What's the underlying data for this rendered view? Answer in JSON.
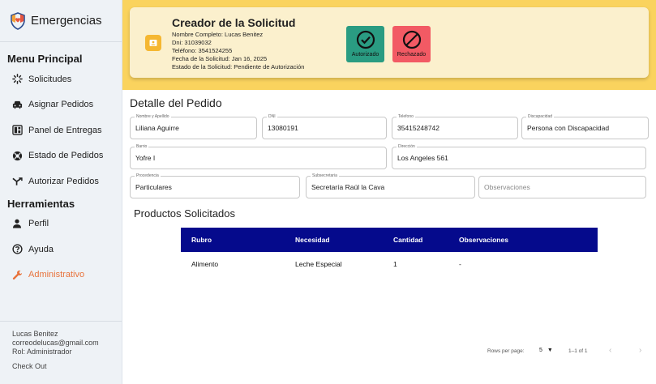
{
  "sidebar": {
    "brand": "Emergencias",
    "section_main": "Menu Principal",
    "main_items": [
      {
        "label": "Solicitudes",
        "icon": "spinner-icon"
      },
      {
        "label": "Asignar Pedidos",
        "icon": "car-icon"
      },
      {
        "label": "Panel de Entregas",
        "icon": "dashboard-icon"
      },
      {
        "label": "Estado de Pedidos",
        "icon": "support-icon"
      },
      {
        "label": "Autorizar Pedidos",
        "icon": "merge-icon"
      }
    ],
    "section_tools": "Herramientas",
    "tool_items": [
      {
        "label": "Perfil",
        "icon": "person-icon"
      },
      {
        "label": "Ayuda",
        "icon": "help-icon"
      },
      {
        "label": "Administrativo",
        "icon": "wrench-icon",
        "active": true
      }
    ],
    "user": {
      "name": "Lucas Benitez",
      "email": "correodelucas@gmail.com",
      "role": "Rol: Administrador",
      "checkout": "Check Out"
    }
  },
  "request": {
    "title": "Creador de la Solicitud",
    "name_line": "Nombre Completo: Lucas Benitez",
    "dni_line": "Dni: 31039032",
    "phone_line": "Teléfono: 3541524255",
    "date_line": "Fecha de la Solicitud: Jan 16, 2025",
    "status_line": "Estado de la Solicitud: Pendiente de Autorización",
    "approve_label": "Autorizado",
    "reject_label": "Rechazado"
  },
  "detail": {
    "title": "Detalle del Pedido",
    "fields": {
      "nombre": {
        "label": "Nombre y Apellido",
        "value": "Liliana Aguirre"
      },
      "dni": {
        "label": "DNI",
        "value": "13080191"
      },
      "telefono": {
        "label": "Telefono",
        "value": "35415248742"
      },
      "discapacidad": {
        "label": "Discapacidad",
        "value": "Persona con Discapacidad"
      },
      "barrio": {
        "label": "Barrio",
        "value": "Yofre I"
      },
      "direccion": {
        "label": "Dirección",
        "value": "Los Angeles 561"
      },
      "procedencia": {
        "label": "Procedencia",
        "value": "Particulares"
      },
      "subsecretaria": {
        "label": "Subsecretaria",
        "value": "Secretaría Raúl la Cava"
      },
      "observaciones": {
        "placeholder": "Observaciones"
      }
    }
  },
  "products": {
    "title": "Productos Solicitados",
    "columns": [
      "Rubro",
      "Necesidad",
      "Cantidad",
      "Observaciones"
    ],
    "rows": [
      [
        "Alimento",
        "Leche Especial",
        "1",
        "-"
      ]
    ],
    "header_color": "#050a8c"
  },
  "pagination": {
    "rows_per_page_label": "Rows per page:",
    "rows_per_page": "5",
    "range": "1–1 of 1"
  },
  "colors": {
    "banner": "#fad35e",
    "approve": "#2a9c82",
    "reject": "#f25a64",
    "active_nav": "#e8733c"
  }
}
